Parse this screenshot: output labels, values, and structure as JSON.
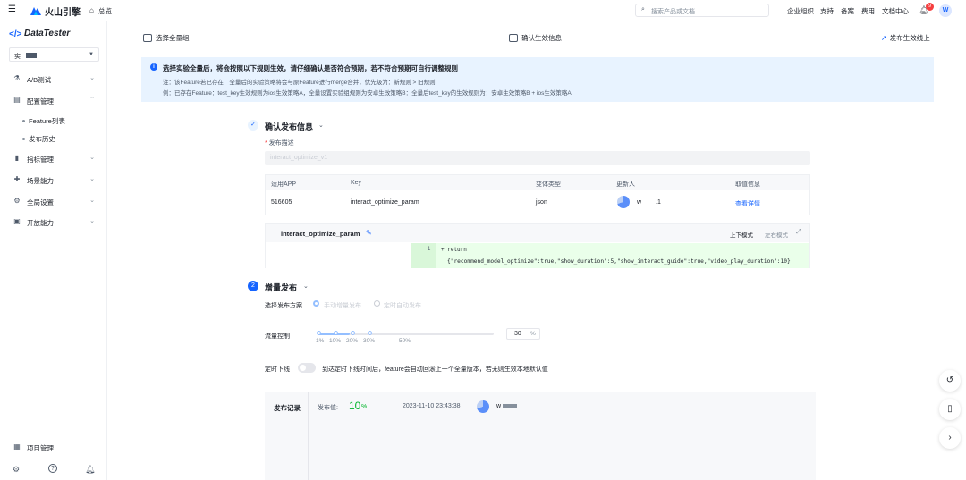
{
  "topbar": {
    "brand": "火山引擎",
    "overview": "总览",
    "search_placeholder": "搜索产品或文档",
    "nav": [
      "企业组织",
      "支持",
      "备案",
      "费用",
      "文档中心"
    ],
    "notif_count": "9",
    "user_initial": "W"
  },
  "sidebar": {
    "product": "DataTester",
    "instance": "实",
    "items": [
      {
        "label": "A/B测试",
        "icon": "flask-icon"
      },
      {
        "label": "配置管理",
        "icon": "config-icon"
      },
      {
        "label": "指标管理",
        "icon": "bar-chart-icon"
      },
      {
        "label": "场景能力",
        "icon": "puzzle-icon"
      },
      {
        "label": "全局设置",
        "icon": "gear-icon"
      },
      {
        "label": "开放能力",
        "icon": "terminal-icon"
      }
    ],
    "subitems": [
      "Feature列表",
      "发布历史"
    ],
    "bottom": {
      "project": "项目管理"
    }
  },
  "steps": [
    {
      "label": "选择全量组"
    },
    {
      "label": "确认生效信息"
    },
    {
      "label": "发布生效线上"
    }
  ],
  "banner": {
    "title": "选择实验全量后，将会按照以下规则生效，请仔细确认是否符合预期，若不符合预期可自行调整规则",
    "note": "注：该Feature若已存在：全量后的实验策略将会与原Feature进行merge合并，优先级为：新规则 > 旧规则",
    "example": "例：已存在Feature：test_key生效规则为ios生效策略A，全量设置实验组规则为安卓生效策略B：全量后test_key的生效规则为：安卓生效策略B + ios生效策略A"
  },
  "confirm": {
    "title": "确认发布信息",
    "desc_label": "* 发布描述",
    "desc_value": "interact_optimize_v1",
    "table": {
      "headers": [
        "适用APP",
        "Key",
        "变体类型",
        "更新人",
        "取值信息"
      ],
      "row": {
        "app": "516605",
        "key": "interact_optimize_param",
        "type": "json",
        "user": "w",
        "user_suffix": ".1",
        "action": "查看详情"
      }
    },
    "code": {
      "name": "interact_optimize_param",
      "mode_updown": "上下模式",
      "mode_lr": "左右模式",
      "line_no": "1",
      "line_1": "+ return",
      "line_2": "{\"recommend_model_optimize\":true,\"show_duration\":5,\"show_interact_guide\":true,\"video_play_duration\":10}"
    }
  },
  "incremental": {
    "step_no": "2",
    "title": "增量发布",
    "plan_label": "选择发布方案",
    "option_manual": "手动增量发布",
    "option_auto": "定时自动发布",
    "traffic_label": "流量控制",
    "ticks": [
      "1%",
      "10%",
      "20%",
      "30%",
      "50%"
    ],
    "traffic_value": "30",
    "traffic_unit": "%",
    "traffic_level": 30,
    "timer_label": "定时下线",
    "timer_desc": "到达定时下线时间后，feature会自动回滚上一个全量版本，若无则生效本地默认值"
  },
  "record": {
    "title": "发布记录",
    "value_label": "发布值:",
    "value": "10",
    "value_unit": "%",
    "time": "2023-11-10 23:43:38",
    "user": "w"
  },
  "colors": {
    "accent": "#1664ff",
    "success": "#00b42a",
    "banner_bg": "#e8f3ff"
  }
}
